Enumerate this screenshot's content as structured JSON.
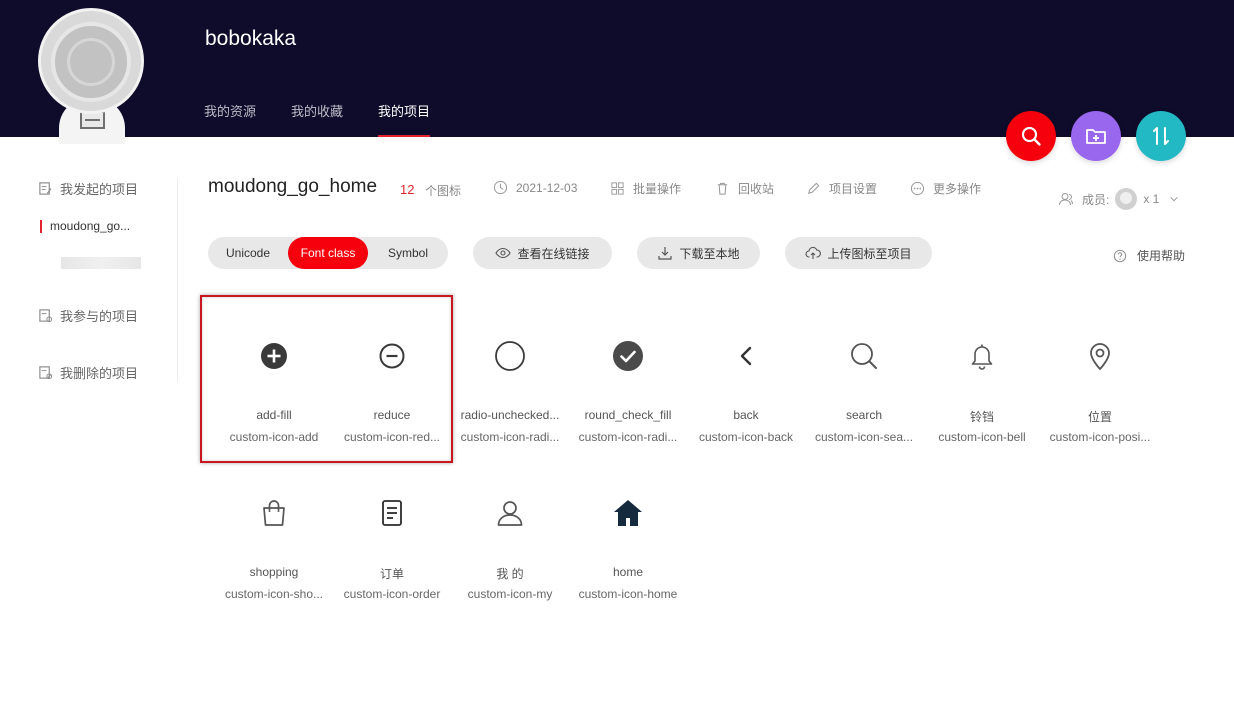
{
  "header": {
    "username": "bobokaka",
    "nav": [
      {
        "label": "我的资源"
      },
      {
        "label": "我的收藏"
      },
      {
        "label": "我的项目"
      }
    ]
  },
  "fabs": {
    "search_color": "#f5000c",
    "add_folder_color": "#9966ee",
    "sort_color": "#22b8c4"
  },
  "sidebar": {
    "my_projects": "我发起的项目",
    "active_project": "moudong_go...",
    "joined_projects": "我参与的项目",
    "deleted_projects": "我删除的项目"
  },
  "project": {
    "title": "moudong_go_home",
    "count": "12",
    "count_label": "个图标",
    "date": "2021-12-03",
    "batch": "批量操作",
    "recycle": "回收站",
    "settings": "项目设置",
    "more": "更多操作",
    "members_label": "成员:",
    "members_count": "x 1"
  },
  "controls": {
    "unicode": "Unicode",
    "font_class": "Font class",
    "symbol": "Symbol",
    "view_link": "查看在线链接",
    "download": "下载至本地",
    "upload": "上传图标至项目",
    "help": "使用帮助"
  },
  "icons": [
    {
      "name": "add-fill",
      "cls": "custom-icon-add",
      "icon": "plus-circle-filled-icon"
    },
    {
      "name": "reduce",
      "cls": "custom-icon-red...",
      "icon": "minus-circle-icon"
    },
    {
      "name": "radio-unchecked...",
      "cls": "custom-icon-radi...",
      "icon": "radio-unchecked-icon"
    },
    {
      "name": "round_check_fill",
      "cls": "custom-icon-radi...",
      "icon": "check-circle-filled-icon"
    },
    {
      "name": "back",
      "cls": "custom-icon-back",
      "icon": "chevron-left-icon"
    },
    {
      "name": "search",
      "cls": "custom-icon-sea...",
      "icon": "search-icon"
    },
    {
      "name": "铃铛",
      "cls": "custom-icon-bell",
      "icon": "bell-icon"
    },
    {
      "name": "位置",
      "cls": "custom-icon-posi...",
      "icon": "location-icon"
    },
    {
      "name": "shopping",
      "cls": "custom-icon-sho...",
      "icon": "shopping-bag-icon"
    },
    {
      "name": "订单",
      "cls": "custom-icon-order",
      "icon": "order-icon"
    },
    {
      "name": "我 的",
      "cls": "custom-icon-my",
      "icon": "user-icon"
    },
    {
      "name": "home",
      "cls": "custom-icon-home",
      "icon": "home-icon"
    }
  ]
}
